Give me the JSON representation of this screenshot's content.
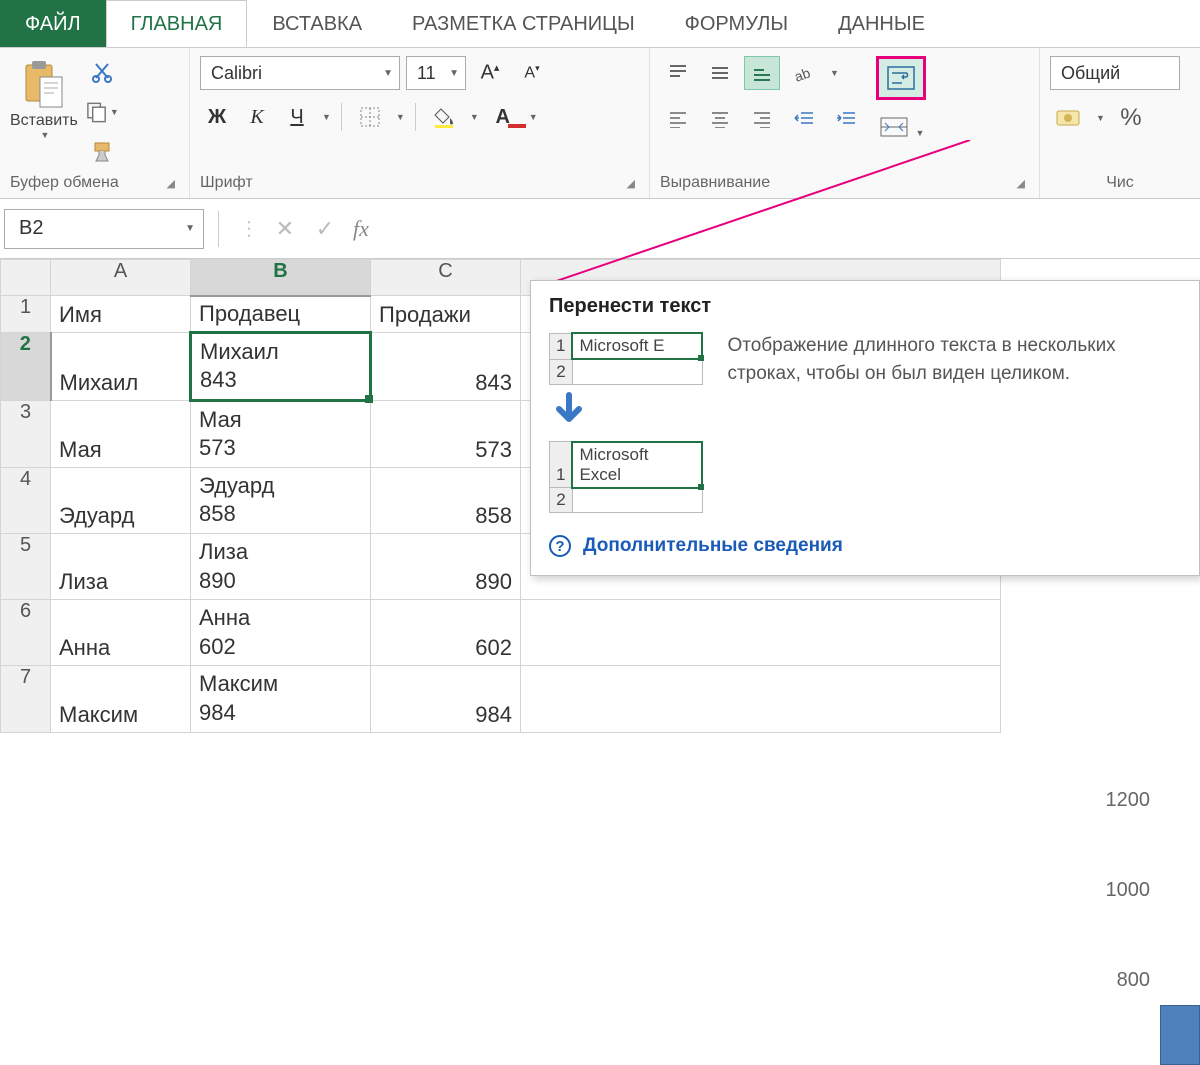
{
  "tabs": {
    "file": "ФАЙЛ",
    "home": "ГЛАВНАЯ",
    "insert": "ВСТАВКА",
    "page_layout": "РАЗМЕТКА СТРАНИЦЫ",
    "formulas": "ФОРМУЛЫ",
    "data": "ДАННЫЕ"
  },
  "ribbon": {
    "clipboard": {
      "paste": "Вставить",
      "label": "Буфер обмена"
    },
    "font": {
      "name": "Calibri",
      "size": "11",
      "bold": "Ж",
      "italic": "К",
      "underline": "Ч",
      "label": "Шрифт"
    },
    "alignment": {
      "label": "Выравнивание"
    },
    "number": {
      "format": "Общий",
      "label": "Чис"
    }
  },
  "namebox": "B2",
  "columns": {
    "A": "A",
    "B": "B",
    "C": "C"
  },
  "rows": {
    "header": {
      "A": "Имя",
      "B": "Продавец",
      "C": "Продажи"
    },
    "data": [
      {
        "n": "1"
      },
      {
        "n": "2",
        "A": "Михаил",
        "B": "Михаил\n843",
        "C": "843"
      },
      {
        "n": "3",
        "A": "Мая",
        "B": "Мая\n573",
        "C": "573"
      },
      {
        "n": "4",
        "A": "Эдуард",
        "B": "Эдуард\n858",
        "C": "858"
      },
      {
        "n": "5",
        "A": "Лиза",
        "B": "Лиза\n890",
        "C": "890"
      },
      {
        "n": "6",
        "A": "Анна",
        "B": "Анна\n602",
        "C": "602"
      },
      {
        "n": "7",
        "A": "Максим",
        "B": "Максим\n984",
        "C": "984"
      }
    ]
  },
  "tooltip": {
    "title": "Перенести текст",
    "desc": "Отображение длинного текста в нескольких строках, чтобы он был виден целиком.",
    "link": "Дополнительные сведения",
    "mini": {
      "before": "Microsoft E",
      "after": "Microsoft\nExcel",
      "r1": "1",
      "r2": "2"
    }
  },
  "chart": {
    "ticks": [
      "1200",
      "1000",
      "800"
    ]
  }
}
